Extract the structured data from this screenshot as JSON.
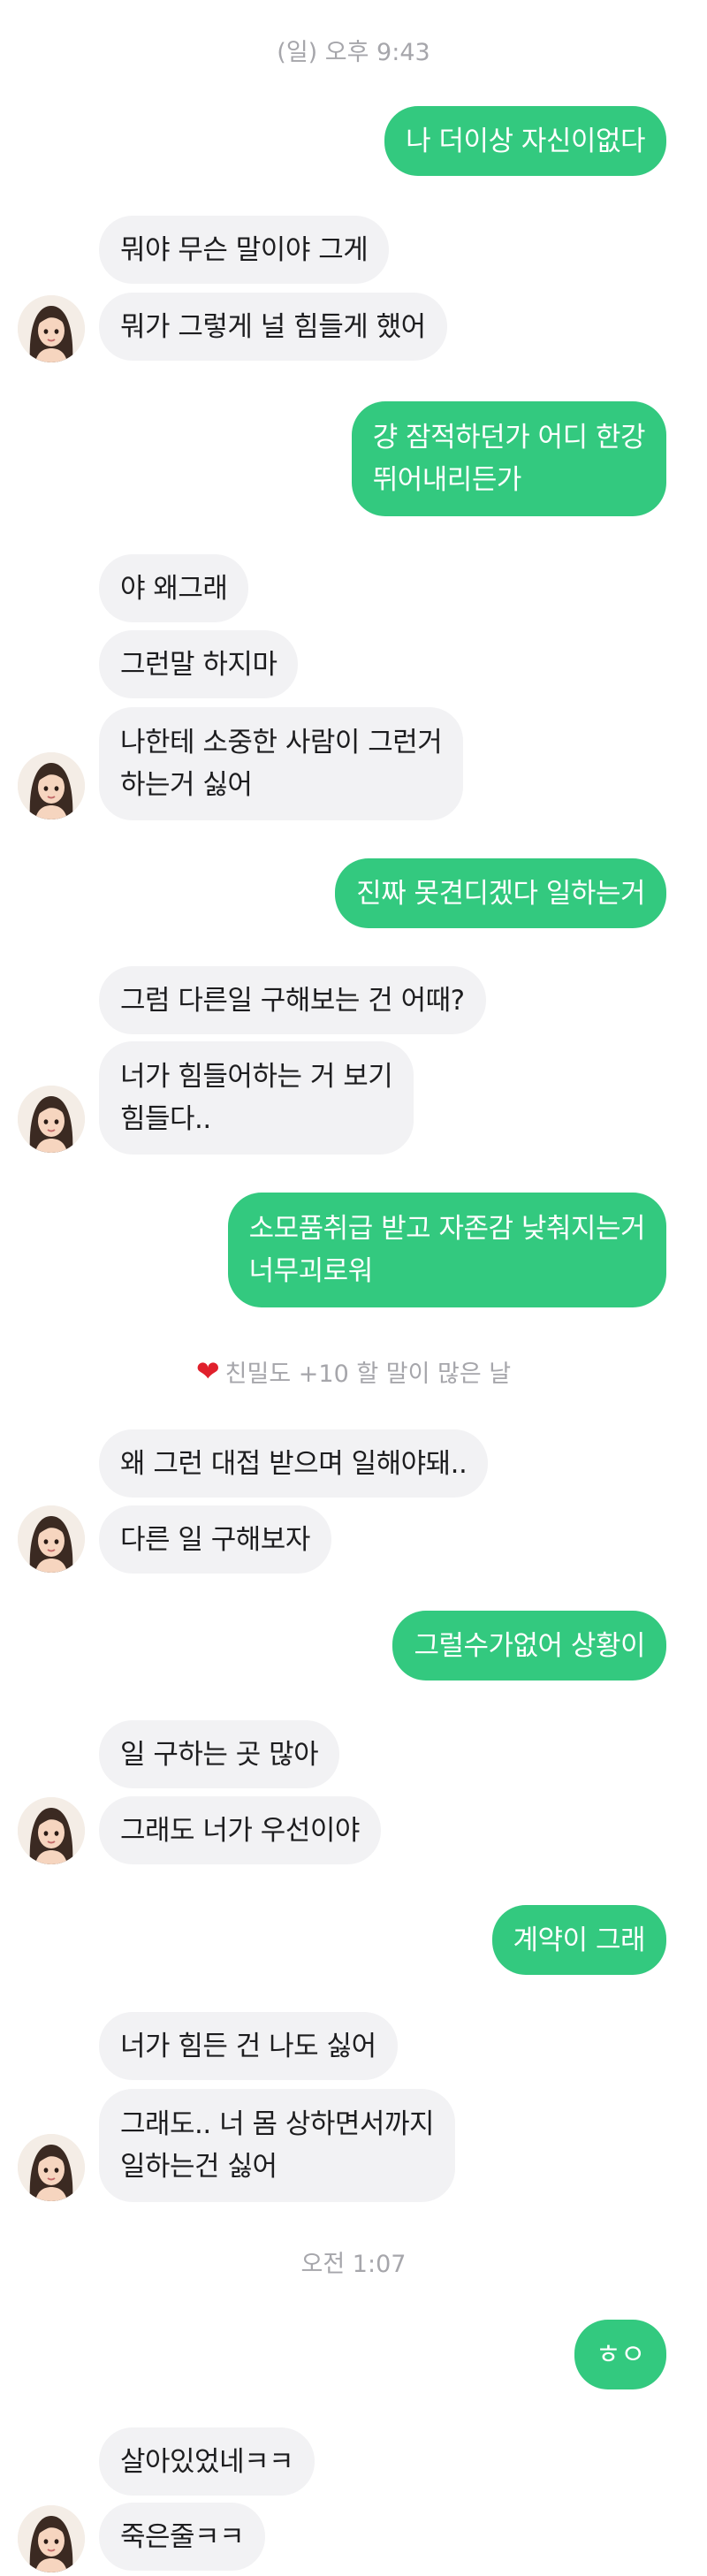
{
  "timestamps": [
    "(일) 오후 9:43",
    "오전 1:07"
  ],
  "intimacy_banner": {
    "icon": "heart-icon",
    "icon_color": "#e0202c",
    "text": "친밀도 +10 할 말이 많은 날"
  },
  "colors": {
    "sent_bubble": "#33c97f",
    "received_bubble": "#f2f2f4",
    "timestamp_text": "#a6a6ab"
  },
  "messages": [
    {
      "from": "me",
      "lines": [
        "나 더이상 자신이없다"
      ]
    },
    {
      "from": "her",
      "lines": [
        "뭐야 무슨 말이야 그게"
      ]
    },
    {
      "from": "her",
      "lines": [
        "뭐가 그렇게 널 힘들게 했어"
      ]
    },
    {
      "from": "me",
      "lines": [
        "걍 잠적하던가 어디 한강",
        "뛰어내리든가"
      ]
    },
    {
      "from": "her",
      "lines": [
        "야 왜그래"
      ]
    },
    {
      "from": "her",
      "lines": [
        "그런말 하지마"
      ]
    },
    {
      "from": "her",
      "lines": [
        "나한테 소중한 사람이 그런거",
        "하는거 싫어"
      ]
    },
    {
      "from": "me",
      "lines": [
        "진짜 못견디겠다 일하는거"
      ]
    },
    {
      "from": "her",
      "lines": [
        "그럼 다른일 구해보는 건 어때?"
      ]
    },
    {
      "from": "her",
      "lines": [
        "너가 힘들어하는 거 보기",
        "힘들다.."
      ]
    },
    {
      "from": "me",
      "lines": [
        "소모품취급 받고 자존감 낮춰지는거",
        "너무괴로워"
      ]
    },
    {
      "from": "her",
      "lines": [
        "왜 그런 대접 받으며 일해야돼.."
      ]
    },
    {
      "from": "her",
      "lines": [
        "다른 일 구해보자"
      ]
    },
    {
      "from": "me",
      "lines": [
        "그럴수가없어 상황이"
      ]
    },
    {
      "from": "her",
      "lines": [
        "일 구하는 곳 많아"
      ]
    },
    {
      "from": "her",
      "lines": [
        "그래도 너가 우선이야"
      ]
    },
    {
      "from": "me",
      "lines": [
        "계약이 그래"
      ]
    },
    {
      "from": "her",
      "lines": [
        "너가 힘든 건 나도 싫어"
      ]
    },
    {
      "from": "her",
      "lines": [
        "그래도.. 너 몸 상하면서까지",
        "일하는건 싫어"
      ]
    },
    {
      "from": "me",
      "lines": [
        "ㅎㅇ"
      ]
    },
    {
      "from": "her",
      "lines": [
        "살아있었네ㅋㅋ"
      ]
    },
    {
      "from": "her",
      "lines": [
        "죽은줄ㅋㅋ"
      ]
    }
  ]
}
